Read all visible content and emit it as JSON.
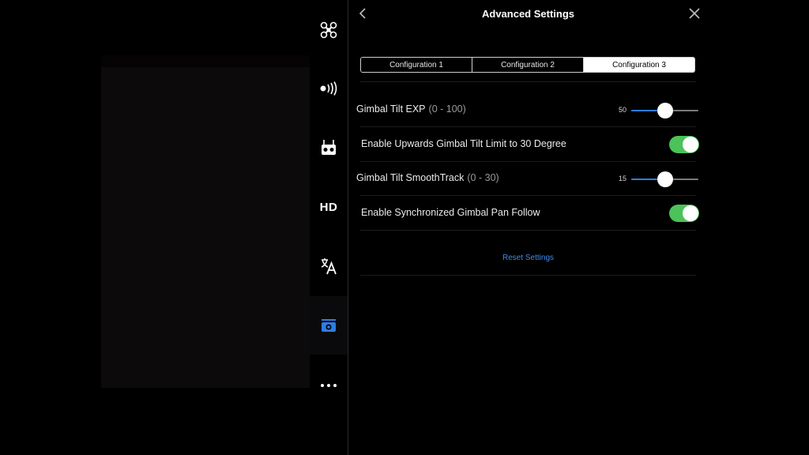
{
  "header": {
    "title": "Advanced Settings"
  },
  "tabs": [
    {
      "label": "Configuration 1",
      "active": false
    },
    {
      "label": "Configuration 2",
      "active": false
    },
    {
      "label": "Configuration 3",
      "active": true
    }
  ],
  "settings": {
    "gimbal_tilt_exp": {
      "label": "Gimbal Tilt EXP",
      "range": "(0 - 100)",
      "value": "50",
      "fraction": 0.5
    },
    "upwards_tilt_limit": {
      "label": "Enable Upwards Gimbal Tilt Limit to 30 Degree",
      "enabled": true
    },
    "gimbal_tilt_smoothtrack": {
      "label": "Gimbal Tilt SmoothTrack",
      "range": "(0 - 30)",
      "value": "15",
      "fraction": 0.5
    },
    "synchronized_pan_follow": {
      "label": "Enable Synchronized Gimbal Pan Follow",
      "enabled": true
    }
  },
  "reset": {
    "label": "Reset Settings"
  },
  "sidebar": {
    "items": [
      {
        "name": "aircraft-icon"
      },
      {
        "name": "sensor-icon"
      },
      {
        "name": "remote-controller-icon"
      },
      {
        "name": "hd-link",
        "label": "HD"
      },
      {
        "name": "language-icon"
      },
      {
        "name": "gimbal-camera-icon",
        "active": true
      },
      {
        "name": "more-icon"
      }
    ]
  },
  "colors": {
    "accent": "#2f7de1",
    "toggle_on": "#4cc25a",
    "link": "#3f8be8"
  }
}
